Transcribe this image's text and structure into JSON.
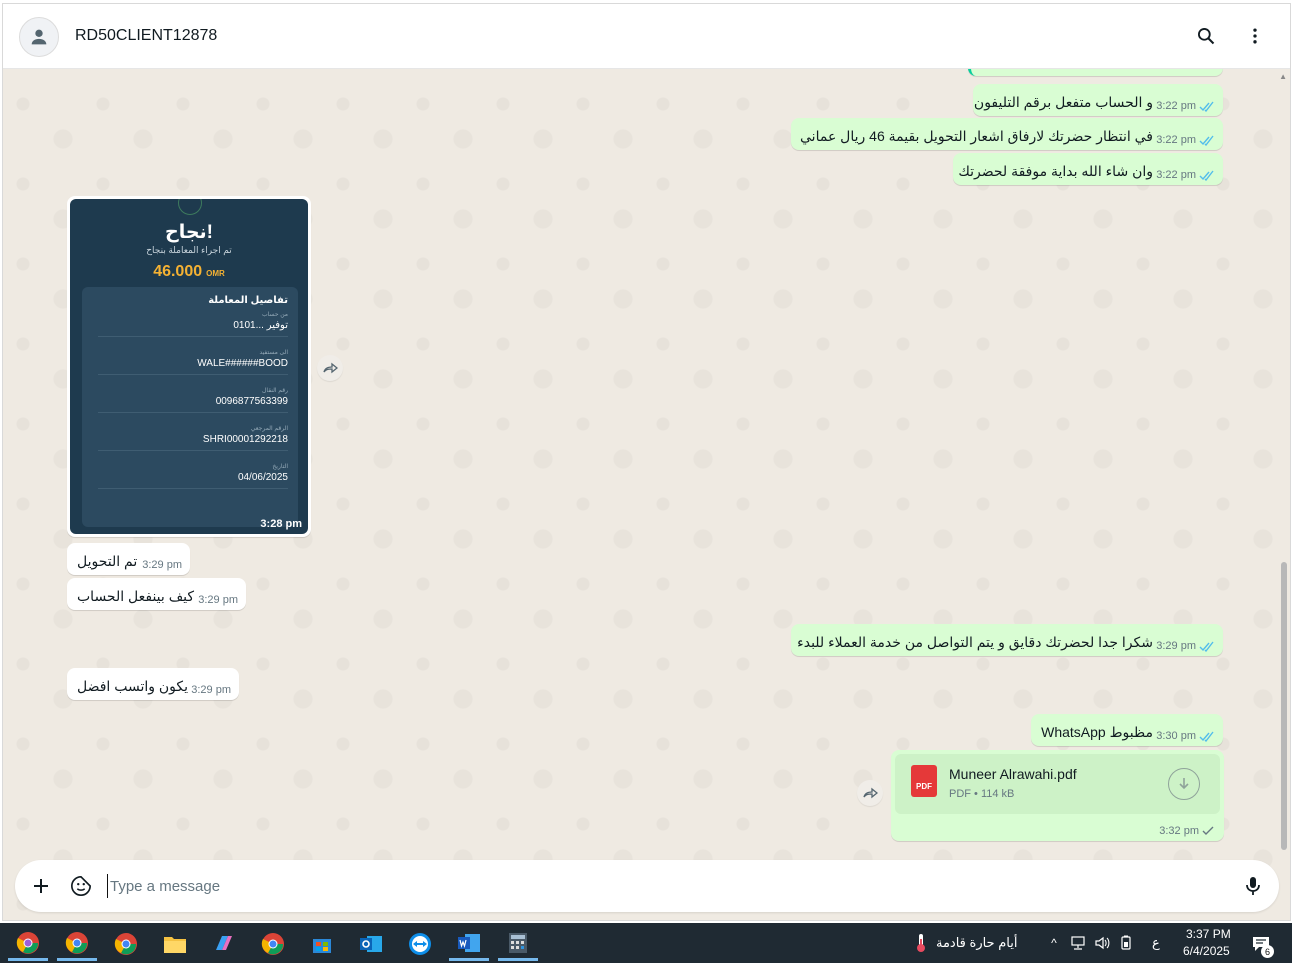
{
  "header": {
    "contact_name": "RD50CLIENT12878"
  },
  "messages": {
    "out1": {
      "text": "و الحساب متفعل برقم التليفون",
      "time": "3:22 pm"
    },
    "out2": {
      "text": "في انتظار حضرتك لارفاق اشعار التحويل بقيمة 46 ريال عماني",
      "time": "3:22 pm"
    },
    "out3": {
      "text": "وان شاء الله بداية موفقة لحضرتك",
      "time": "3:22 pm"
    },
    "in1": {
      "text": "تم التحويل",
      "time": "3:29 pm"
    },
    "in2": {
      "text": "كيف بينفعل الحساب",
      "time": "3:29 pm"
    },
    "out4": {
      "text": "شكرا جدا لحضرتك دقايق و يتم التواصل من خدمة العملاء للبدء",
      "time": "3:29 pm"
    },
    "in3": {
      "text": "يكون واتسب افضل",
      "time": "3:29 pm"
    },
    "out5": {
      "text": "مظبوط WhatsApp",
      "time": "3:30 pm"
    }
  },
  "receipt": {
    "title": "نجاح!",
    "subtitle": "تم اجراء المعاملة بنجاح",
    "amount": "46.000",
    "currency": "OMR",
    "details_title": "تفاصيل المعاملة",
    "rows": [
      {
        "label": "من حساب",
        "value": "توفير ...0101"
      },
      {
        "label": "الى مستفيد",
        "value": "WALE######BOOD"
      },
      {
        "label": "رقم النقال",
        "value": "0096877563399"
      },
      {
        "label": "الرقم المرجعي",
        "value": "SHRI00001292218"
      },
      {
        "label": "التاريخ",
        "value": "04/06/2025"
      }
    ],
    "time": "3:28 pm"
  },
  "pdf": {
    "filename": "Muneer Alrawahi.pdf",
    "badge": "PDF",
    "info": "PDF • 114 kB",
    "time": "3:32 pm"
  },
  "composer": {
    "placeholder": "Type a message"
  },
  "taskbar": {
    "weather": "أيام حارة قادمة",
    "lang": "ع",
    "time": "3:37 PM",
    "date": "6/4/2025",
    "notifications": "6"
  },
  "colors": {
    "outgoing_bubble": "#d9fdd3",
    "incoming_bubble": "#ffffff",
    "read_ticks": "#53bdeb",
    "chat_background": "#efeae2"
  }
}
